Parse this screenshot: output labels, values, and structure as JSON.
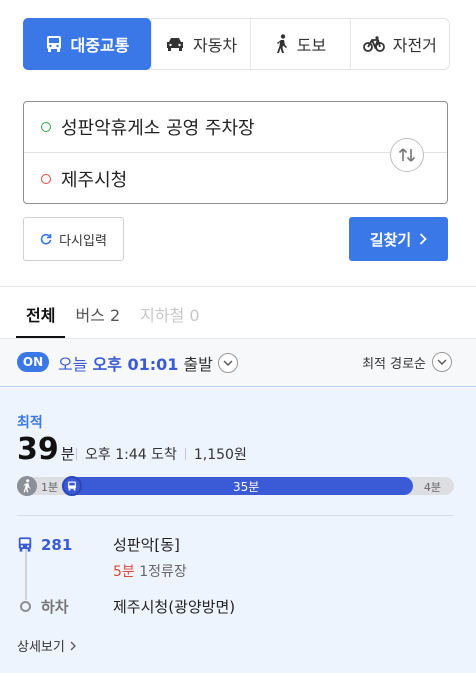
{
  "modes": [
    {
      "label": "대중교통",
      "icon": "bus-icon",
      "active": true
    },
    {
      "label": "자동차",
      "icon": "car-icon",
      "active": false
    },
    {
      "label": "도보",
      "icon": "walk-icon",
      "active": false
    },
    {
      "label": "자전거",
      "icon": "bicycle-icon",
      "active": false
    }
  ],
  "route": {
    "origin": "성판악휴게소 공영 주차장",
    "destination": "제주시청"
  },
  "actions": {
    "reset_label": "다시입력",
    "search_label": "길찾기"
  },
  "result_tabs": [
    {
      "label": "전체",
      "state": "active"
    },
    {
      "label": "버스 2",
      "state": "normal"
    },
    {
      "label": "지하철 0",
      "state": "disabled"
    }
  ],
  "departure": {
    "badge": "ON",
    "today": "오늘",
    "time": "오후 01:01",
    "suffix": "출발",
    "sort_label": "최적 경로순"
  },
  "result": {
    "tag": "최적",
    "duration_num": "39",
    "duration_unit": "분",
    "arrival": "오후 1:44 도착",
    "fare": "1,150원",
    "timeline": {
      "walk_start": "1분",
      "bus": "35분",
      "walk_end": "4분"
    },
    "steps": {
      "bus_number": "281",
      "board_stop": "성판악[동]",
      "wait_min": "5분",
      "stops": "1정류장",
      "off_label": "하차",
      "alight_stop": "제주시청(광양방면)"
    },
    "detail_label": "상세보기"
  },
  "colors": {
    "accent": "#3b78e7",
    "bus": "#3b5bd6",
    "origin_dot": "#2eaa4a",
    "dest_dot": "#e0463b"
  }
}
